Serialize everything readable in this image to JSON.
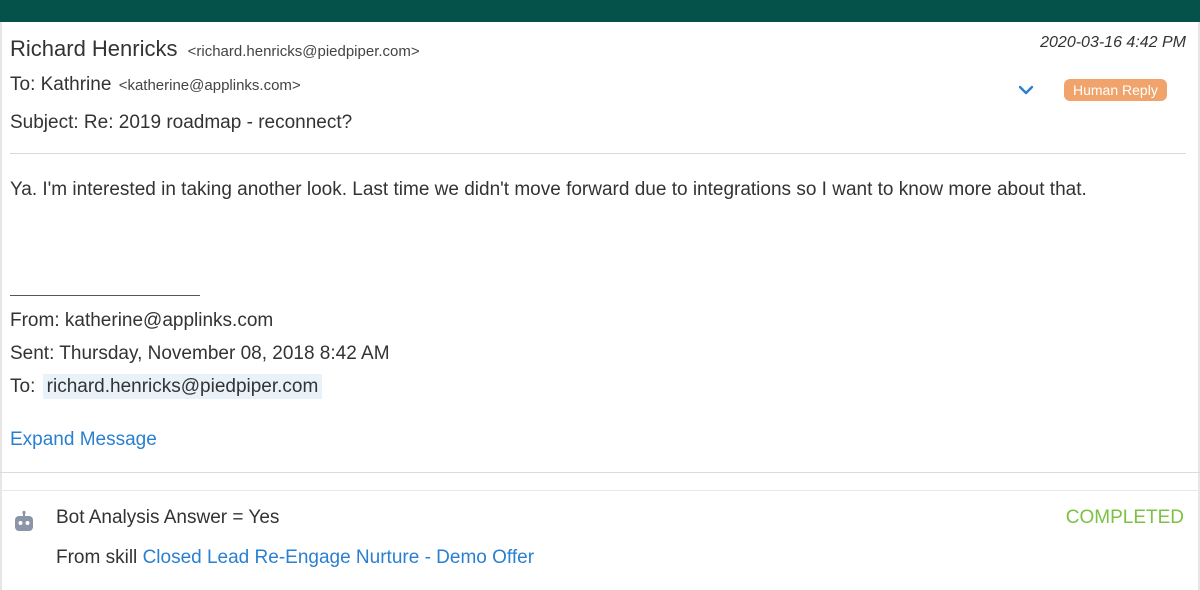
{
  "email": {
    "sender_name": "Richard Henricks",
    "sender_email": "<richard.henricks@piedpiper.com>",
    "timestamp": "2020-03-16 4:42 PM",
    "to_prefix": "To: Kathrine",
    "to_email": "<katherine@applinks.com>",
    "subject": "Subject: Re: 2019 roadmap - reconnect?",
    "badge": "Human Reply",
    "body": "Ya. I'm interested in taking another look. Last time we didn't move forward due to integrations so I want to know more about that."
  },
  "quoted": {
    "from": "From: katherine@applinks.com",
    "sent": "Sent: Thursday, November 08, 2018 8:42 AM",
    "to_prefix": "To:",
    "to_link": "richard.henricks@piedpiper.com",
    "expand_label": "Expand Message"
  },
  "bot": {
    "answer": "Bot Analysis Answer = Yes",
    "status": "COMPLETED",
    "skill_prefix": "From skill",
    "skill_link": "Closed Lead Re-Engage Nurture - Demo Offer"
  },
  "icons": {
    "chevron": "chevron-down-icon",
    "bot": "bot-icon"
  },
  "colors": {
    "topbar": "#04524a",
    "badge": "#f0a46b",
    "link": "#2a7fd1",
    "status": "#7cc142"
  }
}
